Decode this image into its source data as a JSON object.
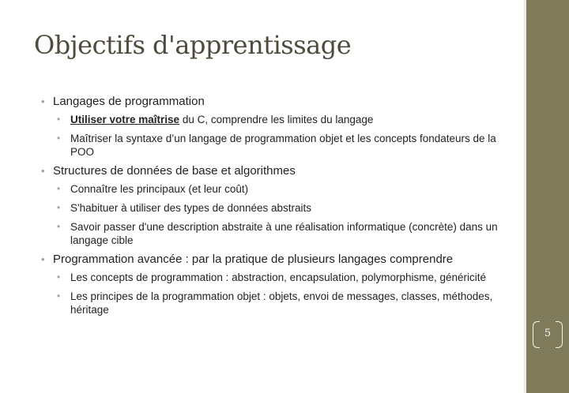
{
  "slide": {
    "title": "Objectifs d'apprentissage",
    "page_number": "5",
    "sections": [
      {
        "text": "Langages de programmation",
        "items": [
          {
            "strong": "Utiliser votre maîtrise",
            "text": " du C, comprendre les limites du langage"
          },
          {
            "text": "Maîtriser la syntaxe d’un langage de programmation objet et les concepts fondateurs de la POO"
          }
        ]
      },
      {
        "text": "Structures de données de base et algorithmes",
        "items": [
          {
            "text": "Connaître les principaux (et leur coût)"
          },
          {
            "text": "S'habituer à utiliser des types de données abstraits"
          },
          {
            "text": "Savoir passer d'une description abstraite à une réalisation informatique (concrète) dans un langage cible"
          }
        ]
      },
      {
        "text": "Programmation avancée : par la pratique de plusieurs langages comprendre",
        "items": [
          {
            "text": "Les concepts de programmation  : abstraction, encapsulation, polymorphisme, généricité"
          },
          {
            "text": "Les principes de la programmation objet : objets, envoi de messages, classes, méthodes, héritage"
          }
        ]
      }
    ]
  },
  "colors": {
    "title": "#4e4b3d",
    "sidebar": "#7f7b5a",
    "bullet": "#a6a48a",
    "text": "#222222"
  }
}
